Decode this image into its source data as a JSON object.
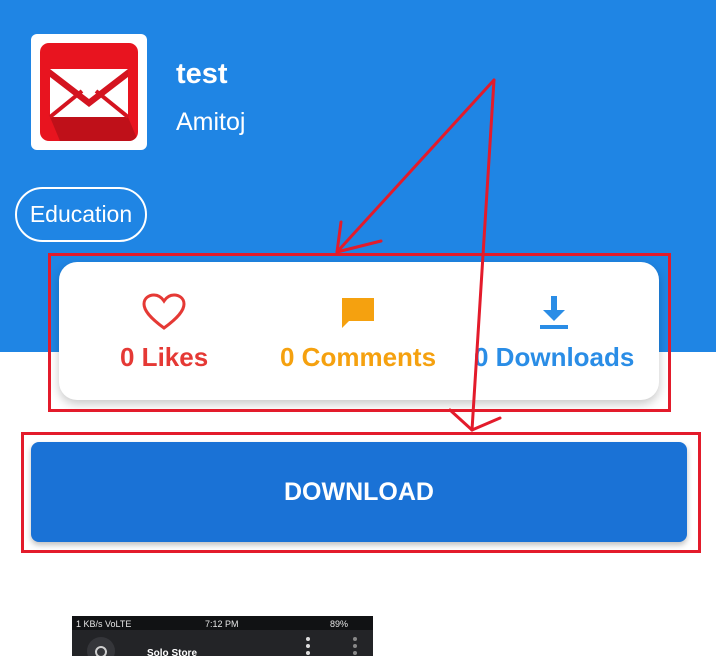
{
  "app": {
    "title": "test",
    "author": "Amitoj",
    "category": "Education",
    "icon": "envelope-icon"
  },
  "stats": {
    "likes_label": "0 Likes",
    "comments_label": "0 Comments",
    "downloads_label": "0 Downloads"
  },
  "download_button": {
    "label": "DOWNLOAD"
  },
  "thumbnail": {
    "status_speed": "1 KB/s VoLTE",
    "status_time": "7:12 PM",
    "status_battery": "89%",
    "app_bar_title": "Solo Store"
  },
  "colors": {
    "header_blue": "#1f85e4",
    "button_blue": "#1a72d6",
    "likes_red": "#e53935",
    "comments_amber": "#f5a10f",
    "downloads_blue": "#2a8de6",
    "annotation_red": "#e31b2b"
  }
}
